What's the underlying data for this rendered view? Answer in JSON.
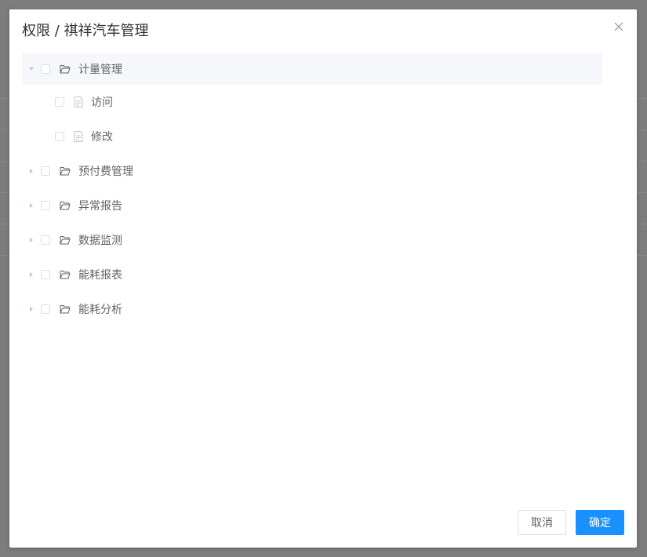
{
  "dialog": {
    "title": "权限 / 祺祥汽车管理",
    "close_icon": "close-icon"
  },
  "tree": [
    {
      "label": "计量管理",
      "expanded": true,
      "children": [
        {
          "label": "访问"
        },
        {
          "label": "修改"
        }
      ]
    },
    {
      "label": "预付费管理",
      "expanded": false
    },
    {
      "label": "异常报告",
      "expanded": false
    },
    {
      "label": "数据监测",
      "expanded": false
    },
    {
      "label": "能耗报表",
      "expanded": false
    },
    {
      "label": "能耗分析",
      "expanded": false
    }
  ],
  "footer": {
    "cancel_label": "取消",
    "ok_label": "确定"
  },
  "colors": {
    "primary": "#1890ff",
    "text": "#606266",
    "border": "#dcdfe6",
    "active_bg": "#f5f7fa"
  }
}
